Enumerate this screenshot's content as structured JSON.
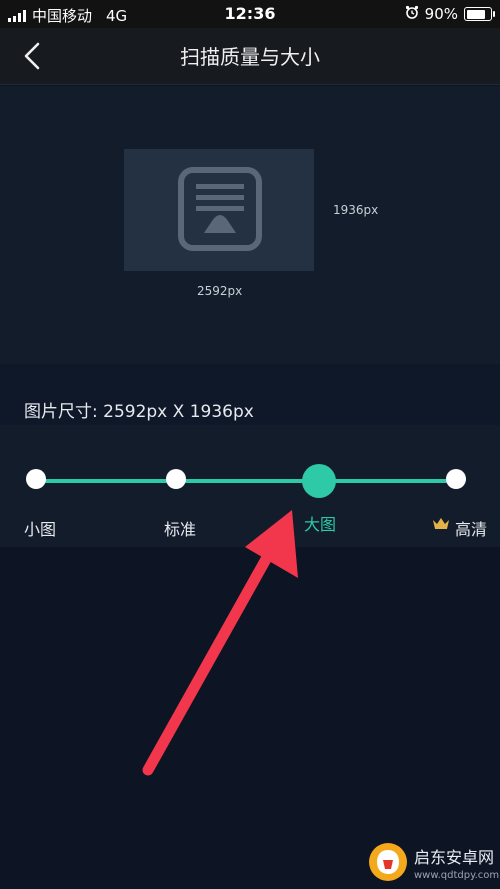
{
  "status_bar": {
    "carrier": "中国移动",
    "network": "4G",
    "time": "12:36",
    "battery_percent": "90%",
    "battery_level": 0.9
  },
  "nav": {
    "title": "扫描质量与大小"
  },
  "preview": {
    "height_label": "1936px",
    "width_label": "2592px"
  },
  "image_size": {
    "text": "图片尺寸:  2592px X 1936px"
  },
  "quality_options": {
    "items": [
      {
        "label": "小图"
      },
      {
        "label": "标准"
      },
      {
        "label": "大图"
      },
      {
        "label": "高清"
      }
    ],
    "selected_index": 2
  },
  "colors": {
    "accent": "#2ec9a7",
    "annotation_arrow": "#f2364c",
    "crown": "#e3b24a"
  },
  "watermark": {
    "text": "启东安卓网",
    "url": "www.qdtdpy.com"
  }
}
